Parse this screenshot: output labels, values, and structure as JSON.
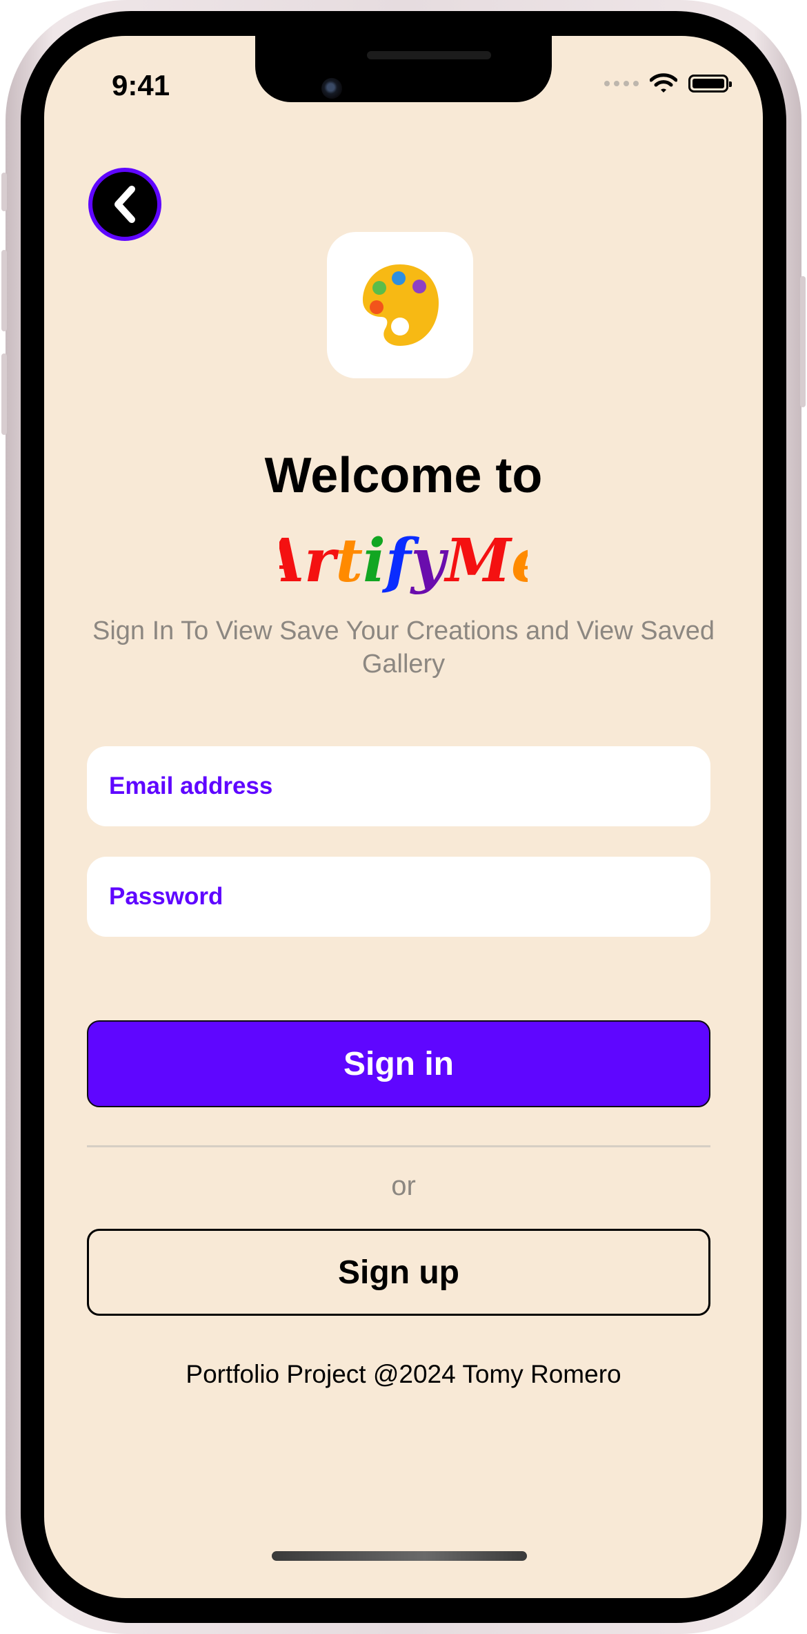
{
  "status_bar": {
    "time": "9:41"
  },
  "header": {
    "back_icon": "chevron-left-icon"
  },
  "app_icon": {
    "icon": "palette-icon"
  },
  "welcome": {
    "title": "Welcome to"
  },
  "brand": {
    "name": "ArtifyMe",
    "letters": [
      {
        "char": "A",
        "color": "#f41111"
      },
      {
        "char": "r",
        "color": "#f41111"
      },
      {
        "char": "t",
        "color": "#ff8a00"
      },
      {
        "char": "i",
        "color": "#12a622"
      },
      {
        "char": "f",
        "color": "#0a2cff"
      },
      {
        "char": "y",
        "color": "#6a0dad"
      },
      {
        "char": "M",
        "color": "#f41111"
      },
      {
        "char": "e",
        "color": "#ff8a00"
      }
    ]
  },
  "subtitle": "Sign In To View Save Your Creations and View Saved Gallery",
  "form": {
    "email_placeholder": "Email address",
    "email_value": "",
    "password_placeholder": "Password",
    "password_value": ""
  },
  "actions": {
    "sign_in": "Sign in",
    "or": "or",
    "sign_up": "Sign up"
  },
  "footer": "Portfolio Project @2024 Tomy Romero",
  "colors": {
    "accent": "#5f06ff",
    "background": "#f8e9d6",
    "muted_text": "#8c8781"
  }
}
